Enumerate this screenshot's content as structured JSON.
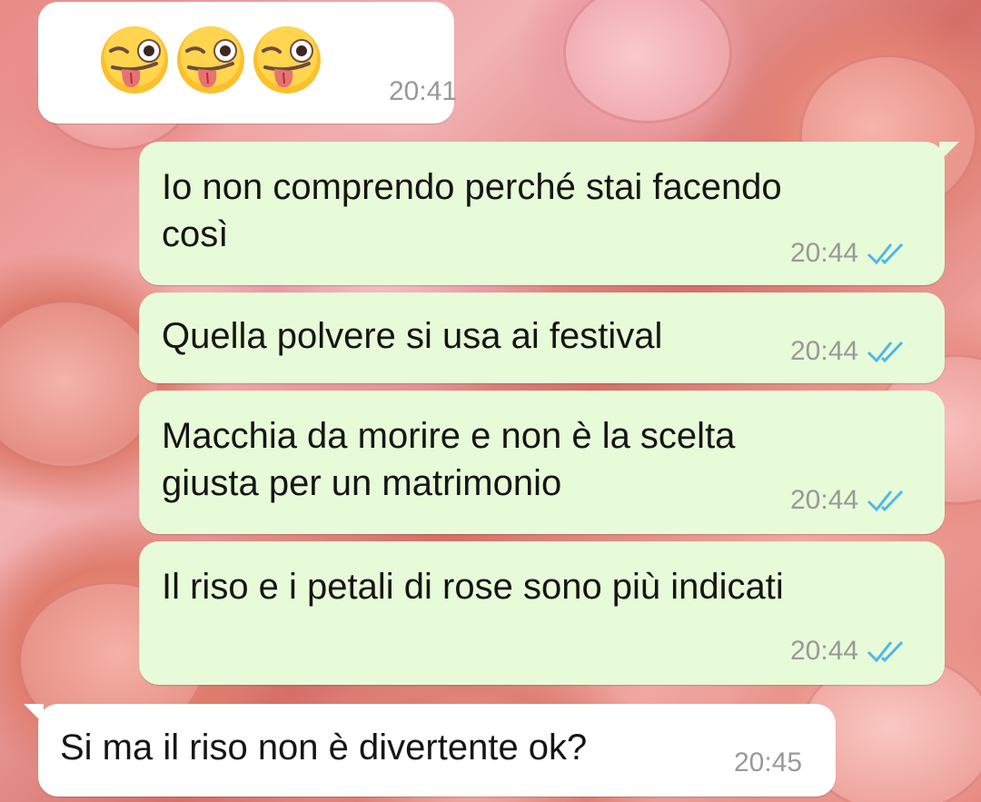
{
  "messages": [
    {
      "direction": "incoming",
      "content": "😜😜😜",
      "emoji_names": [
        "winking-face-with-tongue-icon",
        "winking-face-with-tongue-icon",
        "winking-face-with-tongue-icon"
      ],
      "time": "20:41"
    },
    {
      "direction": "outgoing",
      "lines": [
        "Io non comprendo perché stai facendo",
        "così"
      ],
      "time": "20:44",
      "status": "read"
    },
    {
      "direction": "outgoing",
      "lines": [
        "Quella polvere si usa ai festival"
      ],
      "time": "20:44",
      "status": "read"
    },
    {
      "direction": "outgoing",
      "lines": [
        "Macchia da morire e non è la scelta",
        "giusta per un matrimonio"
      ],
      "time": "20:44",
      "status": "read"
    },
    {
      "direction": "outgoing",
      "lines": [
        "Il riso e i petali di rose sono più indicati"
      ],
      "time": "20:44",
      "status": "read"
    },
    {
      "direction": "incoming",
      "lines": [
        "Si ma il riso non è divertente ok?"
      ],
      "time": "20:45"
    }
  ],
  "colors": {
    "incoming_bubble": "#ffffff",
    "outgoing_bubble": "#e8fbd8",
    "time_text": "#999999",
    "read_ticks": "#4fb6ec",
    "message_text": "#151515"
  },
  "icons": {
    "read_receipt": "double-check-icon",
    "emoji": "winking-face-with-tongue-icon",
    "wallpaper": "pink-roses-wallpaper"
  }
}
